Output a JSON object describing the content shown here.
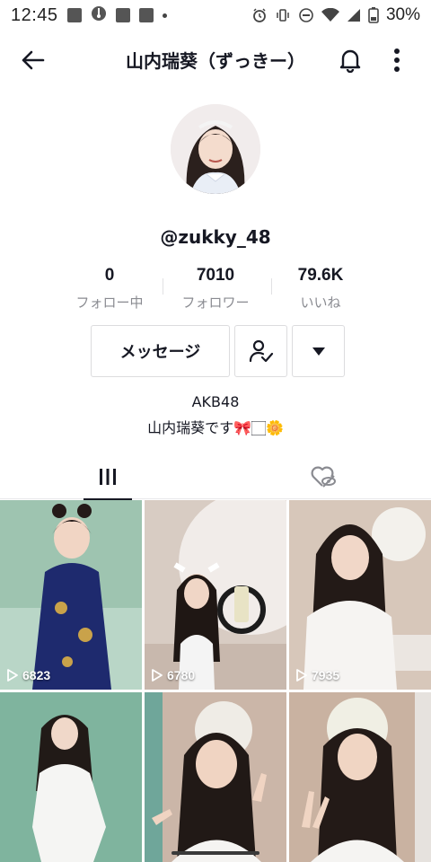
{
  "status_bar": {
    "time": "12:45",
    "battery": "30%",
    "icons": [
      "image-icon",
      "thermometer-icon",
      "app-icon",
      "app-icon",
      "dot-icon",
      "alarm-icon",
      "vibrate-icon",
      "do-not-disturb-icon",
      "wifi-icon",
      "signal-icon",
      "battery-icon"
    ]
  },
  "header": {
    "title": "山内瑞葵（ずっきー）",
    "icons": [
      "back-arrow-icon",
      "bell-icon",
      "more-vertical-icon"
    ]
  },
  "profile": {
    "username": "@zukky_48",
    "stats": [
      {
        "value": "0",
        "label": "フォロー中"
      },
      {
        "value": "7010",
        "label": "フォロワー"
      },
      {
        "value": "79.6K",
        "label": "いいね"
      }
    ],
    "message_label": "メッセージ",
    "bio_line1": "AKB48",
    "bio_line2": "山内瑞葵です🎀🏻🌼"
  },
  "tabs": [
    {
      "icon": "videos-grid-icon",
      "active": true
    },
    {
      "icon": "liked-hidden-icon",
      "active": false
    }
  ],
  "videos": [
    {
      "views": "6823"
    },
    {
      "views": "6780"
    },
    {
      "views": "7935"
    },
    {
      "views": ""
    },
    {
      "views": ""
    },
    {
      "views": ""
    }
  ],
  "colors": {
    "text": "#161823",
    "secondary_text": "#8a8b91",
    "border": "#dcdcde",
    "background": "#ffffff"
  }
}
